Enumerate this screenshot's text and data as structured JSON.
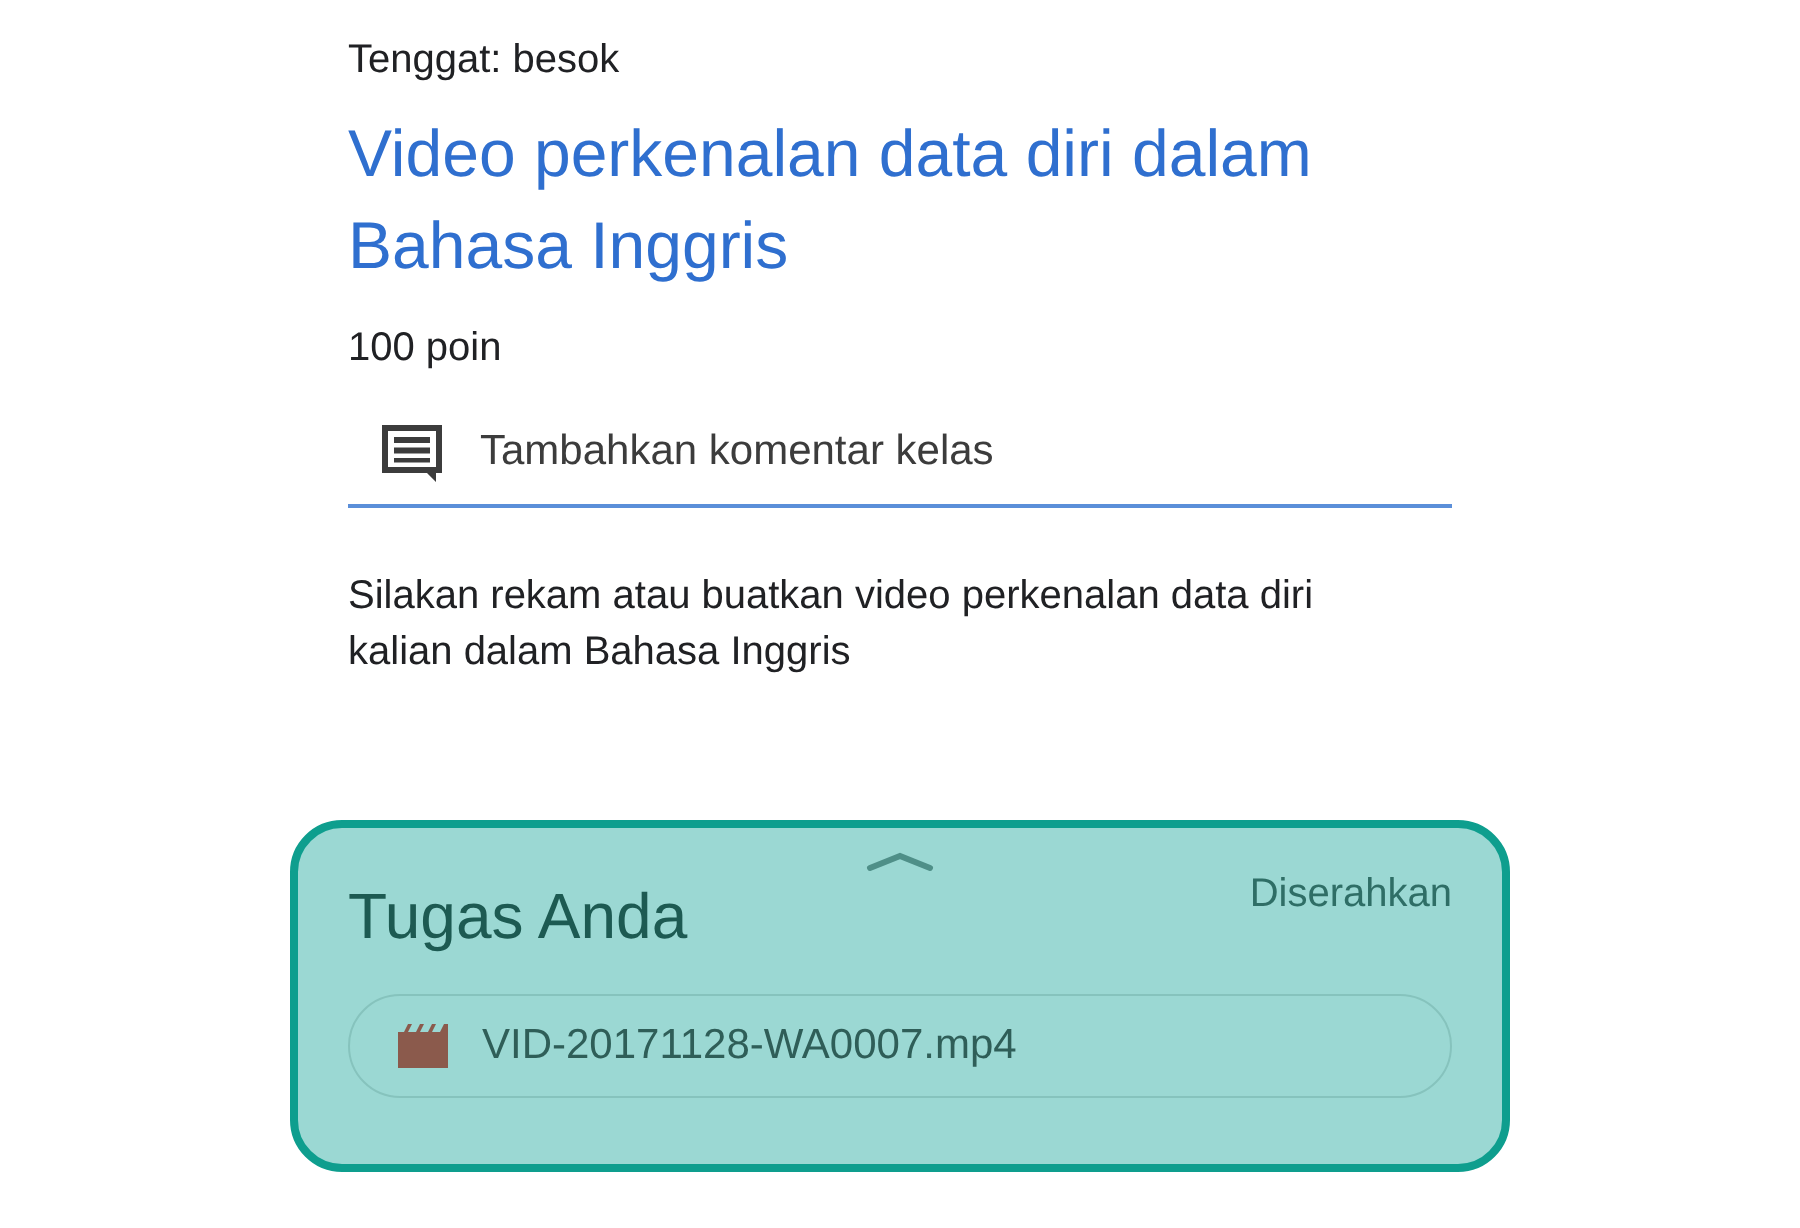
{
  "deadline": "Tenggat: besok",
  "title": "Video perkenalan data diri dalam Bahasa Inggris",
  "points": "100 poin",
  "comment_field": {
    "placeholder": "Tambahkan komentar kelas"
  },
  "description": "Silakan rekam atau buatkan video perkenalan data diri kalian dalam Bahasa Inggris",
  "work_panel": {
    "title": "Tugas Anda",
    "status": "Diserahkan",
    "attachments": [
      {
        "name": "VID-20171128-WA0007.mp4",
        "kind": "video"
      }
    ]
  }
}
